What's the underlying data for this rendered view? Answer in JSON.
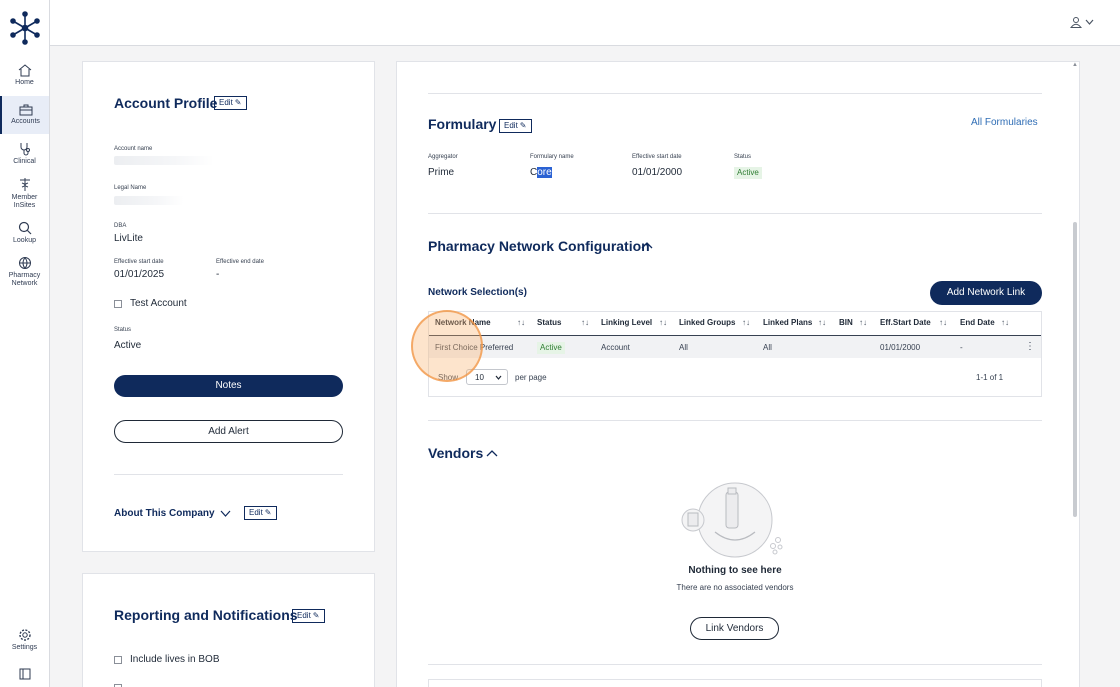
{
  "sidebar": {
    "items": [
      {
        "label": "Home",
        "icon": "home-icon"
      },
      {
        "label": "Accounts",
        "icon": "briefcase-icon",
        "active": true
      },
      {
        "label": "Clinical",
        "icon": "stethoscope-icon"
      },
      {
        "label": "Member InSites",
        "icon": "caduceus-icon"
      },
      {
        "label": "Lookup",
        "icon": "search-icon"
      },
      {
        "label": "Pharmacy Network",
        "icon": "globe-icon"
      }
    ],
    "settings_label": "Settings"
  },
  "profile": {
    "title": "Account Profile",
    "edit_label": "Edit",
    "account_name_label": "Account name",
    "legal_name_label": "Legal Name",
    "dba_label": "DBA",
    "dba_value": "LivLite",
    "eff_start_label": "Effective start date",
    "eff_start_value": "01/01/2025",
    "eff_end_label": "Effective end date",
    "eff_end_value": "-",
    "test_account_label": "Test Account",
    "status_label": "Status",
    "status_value": "Active",
    "notes_label": "Notes",
    "add_alert_label": "Add Alert",
    "about_label": "About This Company"
  },
  "reporting": {
    "title": "Reporting and Notifications",
    "edit_label": "Edit",
    "include_lives_label": "Include lives in BOB"
  },
  "formulary": {
    "title": "Formulary",
    "edit_label": "Edit",
    "all_link": "All Formularies",
    "aggregator_label": "Aggregator",
    "aggregator_value": "Prime",
    "name_label": "Formulary name",
    "name_prefix": "C",
    "name_selected": "ore",
    "eff_label": "Effective start date",
    "eff_value": "01/01/2000",
    "status_label": "Status",
    "status_value": "Active"
  },
  "pharmacy": {
    "title": "Pharmacy Network Configuration",
    "selection_title": "Network Selection(s)",
    "add_link_label": "Add Network Link",
    "columns": [
      "Network Name",
      "Status",
      "Linking Level",
      "Linked Groups",
      "Linked Plans",
      "BIN",
      "Eff.Start Date",
      "End Date"
    ],
    "rows": [
      {
        "network_name": "First Choice Preferred",
        "status": "Active",
        "linking_level": "Account",
        "linked_groups": "All",
        "linked_plans": "All",
        "bin": "",
        "eff_start": "01/01/2000",
        "end_date": "-"
      }
    ],
    "show_label": "Show",
    "page_size": "10",
    "per_page_label": "per page",
    "range_label": "1-1 of 1"
  },
  "vendors": {
    "title": "Vendors",
    "empty_title": "Nothing to see here",
    "empty_subtitle": "There are no associated vendors",
    "link_label": "Link Vendors"
  },
  "colors": {
    "brand": "#0f2a5c",
    "link": "#2f6db5",
    "active_green": "#2e7d32"
  }
}
